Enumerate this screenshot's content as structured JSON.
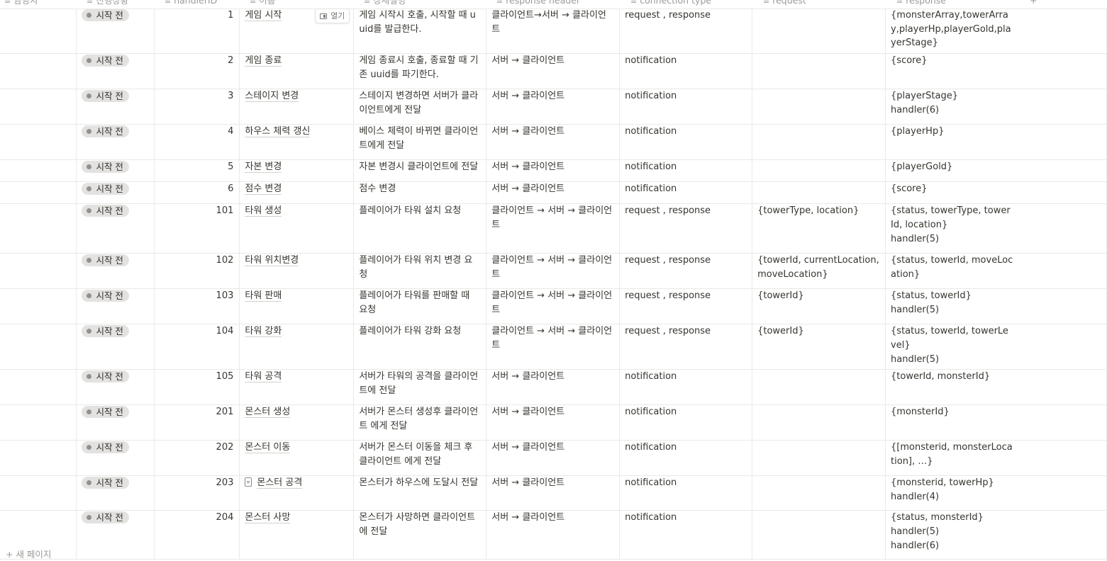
{
  "header": {
    "columns": [
      {
        "icon": "text-icon",
        "label": "담당자"
      },
      {
        "icon": "status-icon",
        "label": "진행상황"
      },
      {
        "icon": "number-icon",
        "label": "handlerID"
      },
      {
        "icon": "title-icon",
        "label": "이름"
      },
      {
        "icon": "text-icon",
        "label": "상세설명"
      },
      {
        "icon": "text-icon",
        "label": "response header"
      },
      {
        "icon": "text-icon",
        "label": "connection type"
      },
      {
        "icon": "text-icon",
        "label": "request"
      },
      {
        "icon": "text-icon",
        "label": "response"
      }
    ]
  },
  "open_label": "열기",
  "rows": [
    {
      "status": "시작 전",
      "id": "1",
      "name": "게임 시작",
      "desc": "게임 시작시 호출, 시작할 때 uuid를 발급한다.",
      "header": "클라이언트→서버 → 클라이언트",
      "conn": "request , response",
      "req": "",
      "res": "{monsterArray,towerArray,playerHp,playerGold,playerStage}",
      "hasOpen": true
    },
    {
      "status": "시작 전",
      "id": "2",
      "name": "게임 종료",
      "desc": "게임 종료시 호출, 종료할 때 기존 uuid를 파기한다.",
      "header": "서버 → 클라이언트",
      "conn": "notification",
      "req": "",
      "res": "{score}"
    },
    {
      "status": "시작 전",
      "id": "3",
      "name": " 스테이지 변경",
      "desc": "스테이지 변경하면 서버가 클라이언트에게 전달",
      "header": "서버 → 클라이언트",
      "conn": "notification",
      "req": "",
      "res": "{playerStage}\nhandler(6)"
    },
    {
      "status": "시작 전",
      "id": "4",
      "name": "하우스 체력 갱신",
      "desc": "베이스 체력이 바뀌면 클라이언트에게 전달",
      "header": "서버 → 클라이언트",
      "conn": "notification",
      "req": "",
      "res": "{playerHp}"
    },
    {
      "status": "시작 전",
      "id": "5",
      "name": "자본 변경",
      "desc": "자본 변경시 클라이언트에 전달",
      "header": "서버 → 클라이언트",
      "conn": "notification",
      "req": "",
      "res": "{playerGold}"
    },
    {
      "status": "시작 전",
      "id": "6",
      "name": "점수 변경",
      "desc": "점수 변경",
      "header": "서버 → 클라이언트",
      "conn": "notification",
      "req": "",
      "res": "{score}"
    },
    {
      "status": "시작 전",
      "id": "101",
      "name": "타워 생성",
      "desc": "플레이어가 타워 설치 요청",
      "header": "클라이언트 → 서버 → 클라이언트",
      "conn": "request , response",
      "req": "{towerType, location}",
      "res": "{status, towerType, towerId, location}\nhandler(5)"
    },
    {
      "status": "시작 전",
      "id": "102",
      "name": "타워 위치변경",
      "desc": "플레이어가 타워 위치 변경 요청",
      "header": "클라이언트 → 서버 → 클라이언트",
      "conn": "request , response",
      "req": "{towerId, currentLocation, moveLocation}",
      "res": "{status, towerId, moveLocation}"
    },
    {
      "status": "시작 전",
      "id": "103",
      "name": "타워 판매",
      "desc": "플레이어가 타워를 판매할 때 요청",
      "header": "클라이언트 → 서버 → 클라이언트",
      "conn": "request , response",
      "req": "{towerId}",
      "res": "{status, towerId}\nhandler(5)"
    },
    {
      "status": "시작 전",
      "id": "104",
      "name": "타워 강화",
      "desc": "플레이어가 타워 강화 요청",
      "header": "클라이언트 → 서버 → 클라이언트",
      "conn": "request , response",
      "req": "{towerId}",
      "res": "{status, towerId, towerLevel}\nhandler(5)"
    },
    {
      "status": "시작 전",
      "id": "105",
      "name": "타워 공격",
      "desc": "서버가 타워의 공격을 클라이언트에 전달",
      "header": "서버 → 클라이언트",
      "conn": "notification",
      "req": "",
      "res": "{towerId, monsterId}"
    },
    {
      "status": "시작 전",
      "id": "201",
      "name": "몬스터 생성",
      "desc": "서버가 몬스터 생성후 클라이언트 에게 전달",
      "header": "서버 → 클라이언트",
      "conn": "notification",
      "req": "",
      "res": "{monsterId}"
    },
    {
      "status": "시작 전",
      "id": "202",
      "name": "몬스터 이동",
      "desc": "서버가 몬스터 이동을 체크 후 클라이언트 에게 전달",
      "header": "서버 → 클라이언트",
      "conn": "notification",
      "req": "",
      "res": "{[monsterid, monsterLocation], …}"
    },
    {
      "status": "시작 전",
      "id": "203",
      "name": "몬스터 공격",
      "desc": "몬스터가 하우스에 도달시 전달",
      "header": "서버 → 클라이언트",
      "conn": "notification",
      "req": "",
      "res": "{monsterid, towerHp}\nhandler(4)",
      "hasDoc": true
    },
    {
      "status": "시작 전",
      "id": "204",
      "name": "몬스터 사망",
      "desc": "몬스터가 사망하면 클라이언트에 전달",
      "header": "서버 → 클라이언트",
      "conn": "notification",
      "req": "",
      "res": "{status, monsterId}\nhandler(5)\nhandler(6)"
    }
  ],
  "footer": {
    "new_page_label": "+ 새 페이지"
  }
}
